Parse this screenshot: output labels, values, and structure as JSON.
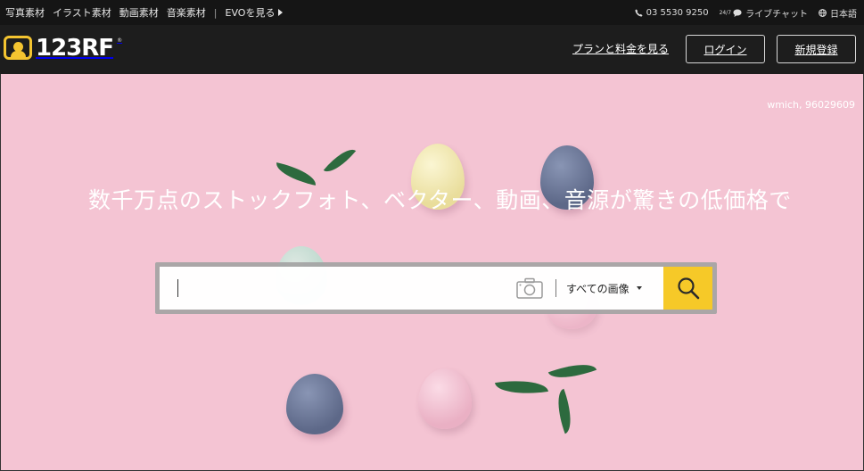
{
  "topbar": {
    "links": [
      "写真素材",
      "イラスト素材",
      "動画素材",
      "音楽素材"
    ],
    "separator": "|",
    "evo": "EVOを見る",
    "phone": "03 5530 9250",
    "support_hours": "24/7",
    "chat": "ライブチャット",
    "language": "日本語"
  },
  "header": {
    "logo_text": "123RF",
    "logo_reg": "®",
    "plans_link": "プランと料金を見る",
    "login": "ログイン",
    "signup": "新規登録"
  },
  "hero": {
    "credit": "wmich, 96029609",
    "headline": "数千万点のストックフォト、ベクター、動画、音源が驚きの低価格で",
    "search": {
      "value": "",
      "placeholder": "",
      "category": "すべての画像"
    }
  },
  "colors": {
    "accent": "#f6c928",
    "hero_bg": "#f4c4d3",
    "header_bg": "#1d1d1d",
    "topbar_bg": "#151515"
  },
  "icons": [
    "phone-icon",
    "chat-icon",
    "globe-icon",
    "camera-icon",
    "search-icon",
    "chevron-right-icon",
    "chevron-down-icon"
  ]
}
